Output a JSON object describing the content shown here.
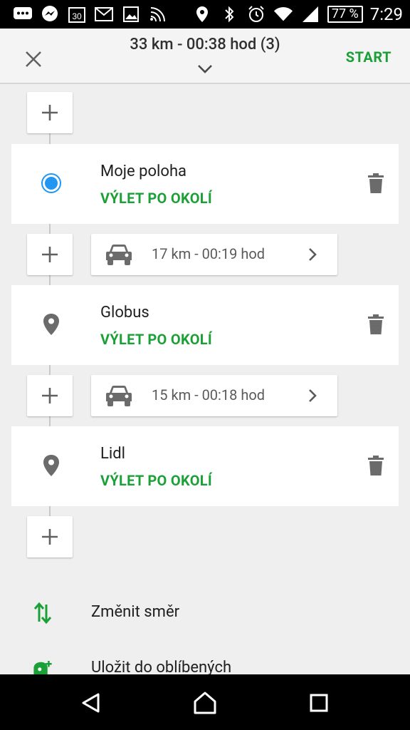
{
  "status_bar": {
    "battery": "77 %",
    "time": "7:29"
  },
  "header": {
    "summary": "33 km - 00:38 hod (3)",
    "start_label": "START"
  },
  "waypoints": [
    {
      "name": "Moje poloha",
      "subtitle": "VÝLET PO OKOLÍ",
      "icon": "current-location-icon"
    },
    {
      "name": "Globus",
      "subtitle": "VÝLET PO OKOLÍ",
      "icon": "location-pin-icon"
    },
    {
      "name": "Lidl",
      "subtitle": "VÝLET PO OKOLÍ",
      "icon": "location-pin-icon"
    }
  ],
  "segments": [
    {
      "text": "17 km - 00:19 hod",
      "icon": "car-icon"
    },
    {
      "text": "15 km - 00:18 hod",
      "icon": "car-icon"
    }
  ],
  "actions": [
    {
      "label": "Změnit směr",
      "icon": "swap-direction-icon"
    },
    {
      "label": "Uložit do oblíbených",
      "icon": "add-favorite-icon"
    }
  ],
  "colors": {
    "accent_green": "#1aa036",
    "location_blue": "#2196f3",
    "icon_gray": "#6b6b6b"
  }
}
